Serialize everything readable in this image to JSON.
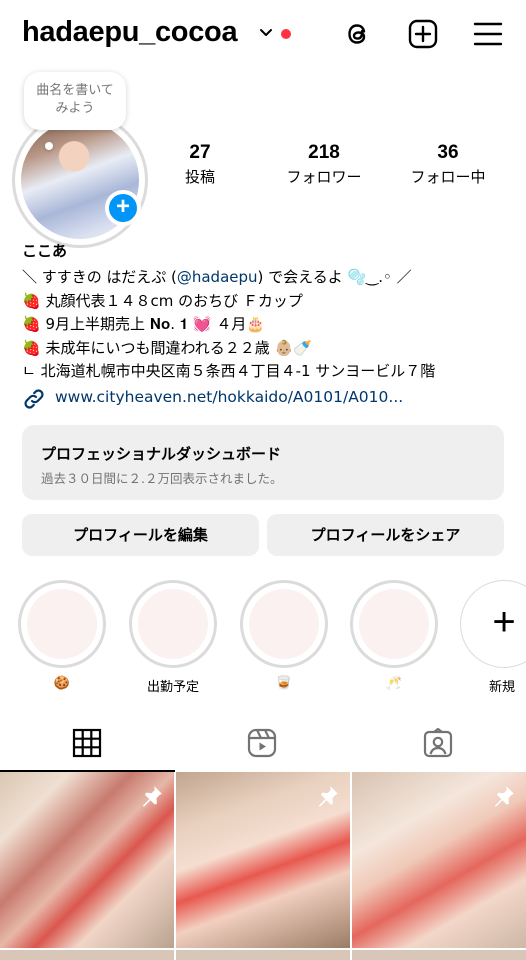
{
  "header": {
    "username": "hadaepu_cocoa",
    "icons": [
      "chevron-down-icon",
      "threads-icon",
      "plus-square-icon",
      "menu-icon"
    ],
    "notification_color": "#ff3040"
  },
  "profile": {
    "note_bubble": "曲名を書いてみよう",
    "stats": [
      {
        "value": "27",
        "label": "投稿"
      },
      {
        "value": "218",
        "label": "フォロワー"
      },
      {
        "value": "36",
        "label": "フォロー中"
      }
    ],
    "display_name": "ここあ",
    "bio_lines": [
      "＼ すすきの はだえぷ (",
      "@hadaepu",
      ") で会えるよ 🫧‿.◦ ／",
      "🍓 丸顔代表１４８cm のおちび Ｆカップ",
      "🍓 9月上半期売上 𝐍𝐨. 𝟏 💓 ４月🎂",
      "🍓 未成年にいつも間違われる２２歳 👶🏼🍼",
      "ㄴ 北海道札幌市中央区南５条西４丁目４-1 サンヨービル７階"
    ],
    "link": "www.cityheaven.net/hokkaido/A0101/A010..."
  },
  "dashboard": {
    "title": "プロフェッショナルダッシュボード",
    "subtitle": "過去３０日間に２.２万回表示されました。"
  },
  "buttons": {
    "edit": "プロフィールを編集",
    "share": "プロフィールをシェア"
  },
  "highlights": [
    {
      "label": "🍪"
    },
    {
      "label": "出勤予定"
    },
    {
      "label": "🥃"
    },
    {
      "label": "🥂"
    },
    {
      "label": "新規"
    }
  ],
  "tabs": [
    "grid-icon",
    "reels-icon",
    "tagged-icon"
  ],
  "accent_color": "#0095f6"
}
